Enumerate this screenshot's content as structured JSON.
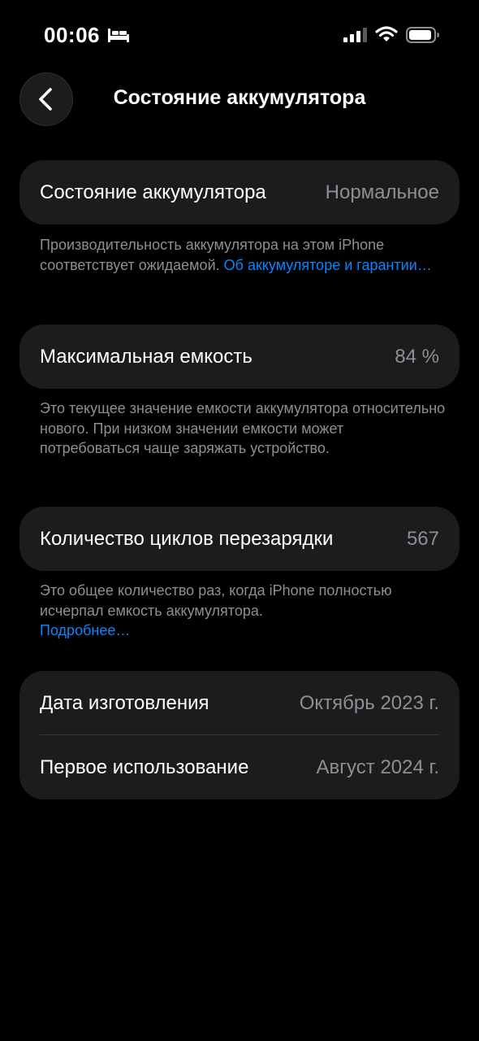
{
  "status_bar": {
    "time": "00:06",
    "icons": [
      "bed-icon",
      "cellular-signal-icon",
      "wifi-icon",
      "battery-icon"
    ]
  },
  "nav": {
    "back_icon": "chevron-left-icon",
    "title": "Состояние аккумулятора"
  },
  "battery_health": {
    "label": "Состояние аккумулятора",
    "value": "Нормальное",
    "footnote_text": "Производительность аккумулятора на этом iPhone соответствует ожидаемой.",
    "footnote_link": "Об аккумуляторе и гарантии…"
  },
  "max_capacity": {
    "label": "Максимальная емкость",
    "value": "84 %",
    "footnote_text": "Это текущее значение емкости аккумулятора относительно нового. При низком значении емкости может потребоваться чаще заряжать устройство."
  },
  "cycle_count": {
    "label": "Количество циклов перезарядки",
    "value": "567",
    "footnote_text": "Это общее количество раз, когда iPhone полностью исчерпал емкость аккумулятора.",
    "footnote_link": "Подробнее…"
  },
  "dates": {
    "manufacture_label": "Дата изготовления",
    "manufacture_value": "Октябрь 2023 г.",
    "first_use_label": "Первое использование",
    "first_use_value": "Август 2024 г."
  },
  "colors": {
    "background": "#000000",
    "card": "#1c1c1e",
    "secondary_text": "#8e8e93",
    "link": "#0a84ff"
  }
}
